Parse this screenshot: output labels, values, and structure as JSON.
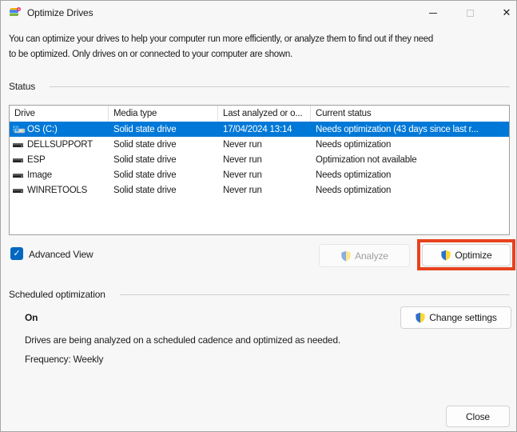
{
  "titlebar": {
    "title": "Optimize Drives"
  },
  "window_controls": {
    "close_glyph": "✕"
  },
  "intro": {
    "line1": "You can optimize your drives to help your computer run more efficiently, or analyze them to find out if they need",
    "line2": "to be optimized. Only drives on or connected to your computer are shown."
  },
  "status_section": {
    "label": "Status"
  },
  "table": {
    "columns": [
      "Drive",
      "Media type",
      "Last analyzed or o...",
      "Current status"
    ],
    "rows": [
      {
        "drive": "OS (C:)",
        "media_type": "Solid state drive",
        "last_analyzed": "17/04/2024 13:14",
        "current_status": "Needs optimization (43 days since last r...",
        "selected": true,
        "icon": "os-drive-icon"
      },
      {
        "drive": "DELLSUPPORT",
        "media_type": "Solid state drive",
        "last_analyzed": "Never run",
        "current_status": "Needs optimization",
        "selected": false,
        "icon": "drive-icon"
      },
      {
        "drive": "ESP",
        "media_type": "Solid state drive",
        "last_analyzed": "Never run",
        "current_status": "Optimization not available",
        "selected": false,
        "icon": "drive-icon"
      },
      {
        "drive": "Image",
        "media_type": "Solid state drive",
        "last_analyzed": "Never run",
        "current_status": "Needs optimization",
        "selected": false,
        "icon": "drive-icon"
      },
      {
        "drive": "WINRETOOLS",
        "media_type": "Solid state drive",
        "last_analyzed": "Never run",
        "current_status": "Needs optimization",
        "selected": false,
        "icon": "drive-icon"
      }
    ]
  },
  "advanced_view": {
    "label": "Advanced View",
    "checked": true,
    "check_glyph": "✓"
  },
  "actions": {
    "analyze_label": "Analyze",
    "optimize_label": "Optimize"
  },
  "scheduled_section": {
    "label": "Scheduled optimization",
    "state": "On",
    "description": "Drives are being analyzed on a scheduled cadence and optimized as needed.",
    "frequency": "Frequency: Weekly",
    "change_settings_label": "Change settings"
  },
  "footer": {
    "close_label": "Close"
  },
  "colors": {
    "selection_blue": "#0078d7",
    "annotation_red": "#e8421e",
    "checkbox_blue": "#0067c0"
  }
}
